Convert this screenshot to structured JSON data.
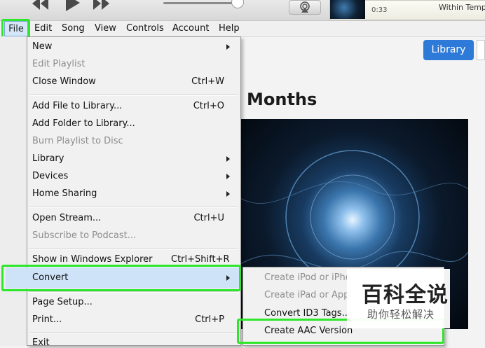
{
  "player": {
    "time": "0:33",
    "title": "Within Temp"
  },
  "menubar": {
    "items": [
      "File",
      "Edit",
      "Song",
      "View",
      "Controls",
      "Account",
      "Help"
    ]
  },
  "content": {
    "library_button": "Library",
    "heading": "Months"
  },
  "file_menu": {
    "new": "New",
    "edit_playlist": "Edit Playlist",
    "close_window": "Close Window",
    "close_window_sc": "Ctrl+W",
    "add_file": "Add File to Library...",
    "add_file_sc": "Ctrl+O",
    "add_folder": "Add Folder to Library...",
    "burn": "Burn Playlist to Disc",
    "library": "Library",
    "devices": "Devices",
    "home_sharing": "Home Sharing",
    "open_stream": "Open Stream...",
    "open_stream_sc": "Ctrl+U",
    "subscribe": "Subscribe to Podcast...",
    "show_explorer": "Show in Windows Explorer",
    "show_explorer_sc": "Ctrl+Shift+R",
    "convert": "Convert",
    "page_setup": "Page Setup...",
    "print": "Print...",
    "print_sc": "Ctrl+P",
    "exit": "Exit"
  },
  "convert_submenu": {
    "create_ipod": "Create iPod or iPho",
    "create_ipad": "Create iPad or Appl",
    "convert_id3": "Convert ID3 Tags...",
    "create_aac": "Create AAC Version"
  },
  "watermark": {
    "title": "百科全说",
    "subtitle": "助你轻松解决"
  },
  "colors": {
    "highlight_green": "#2ee62a",
    "accent_blue": "#2e7ad9",
    "menu_selection": "#cfe3f8"
  }
}
